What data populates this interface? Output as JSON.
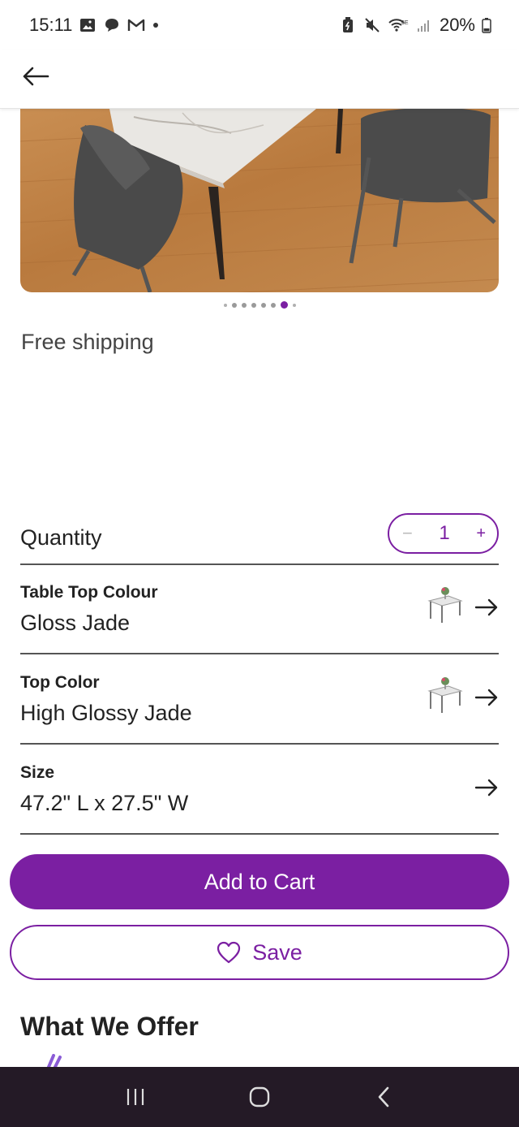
{
  "status_bar": {
    "time": "15:11",
    "battery": "20%",
    "left_icons": [
      "gallery-icon",
      "chat-icon",
      "gmail-icon",
      "dot-icon"
    ],
    "right_icons": [
      "battery-saver-icon",
      "mute-icon",
      "wifi-6e-icon",
      "signal-icon",
      "battery-icon"
    ]
  },
  "top_bar": {
    "back_icon": "arrow-left-icon"
  },
  "gallery": {
    "total_dots": 8,
    "active_index": 6
  },
  "shipping": {
    "text": "Free shipping"
  },
  "quantity": {
    "label": "Quantity",
    "minus": "−",
    "value": "1",
    "plus": "+"
  },
  "options": [
    {
      "label": "Table Top Colour",
      "value": "Gloss Jade",
      "has_thumb": true
    },
    {
      "label": "Top Color",
      "value": "High Glossy Jade",
      "has_thumb": true
    },
    {
      "label": "Size",
      "value": "47.2\" L x 27.5\" W",
      "has_thumb": false
    }
  ],
  "actions": {
    "add_to_cart": "Add to Cart",
    "save": "Save"
  },
  "section": {
    "title": "What We Offer"
  },
  "colors": {
    "brand": "#7b1fa2",
    "nav_bg": "#241a26"
  }
}
